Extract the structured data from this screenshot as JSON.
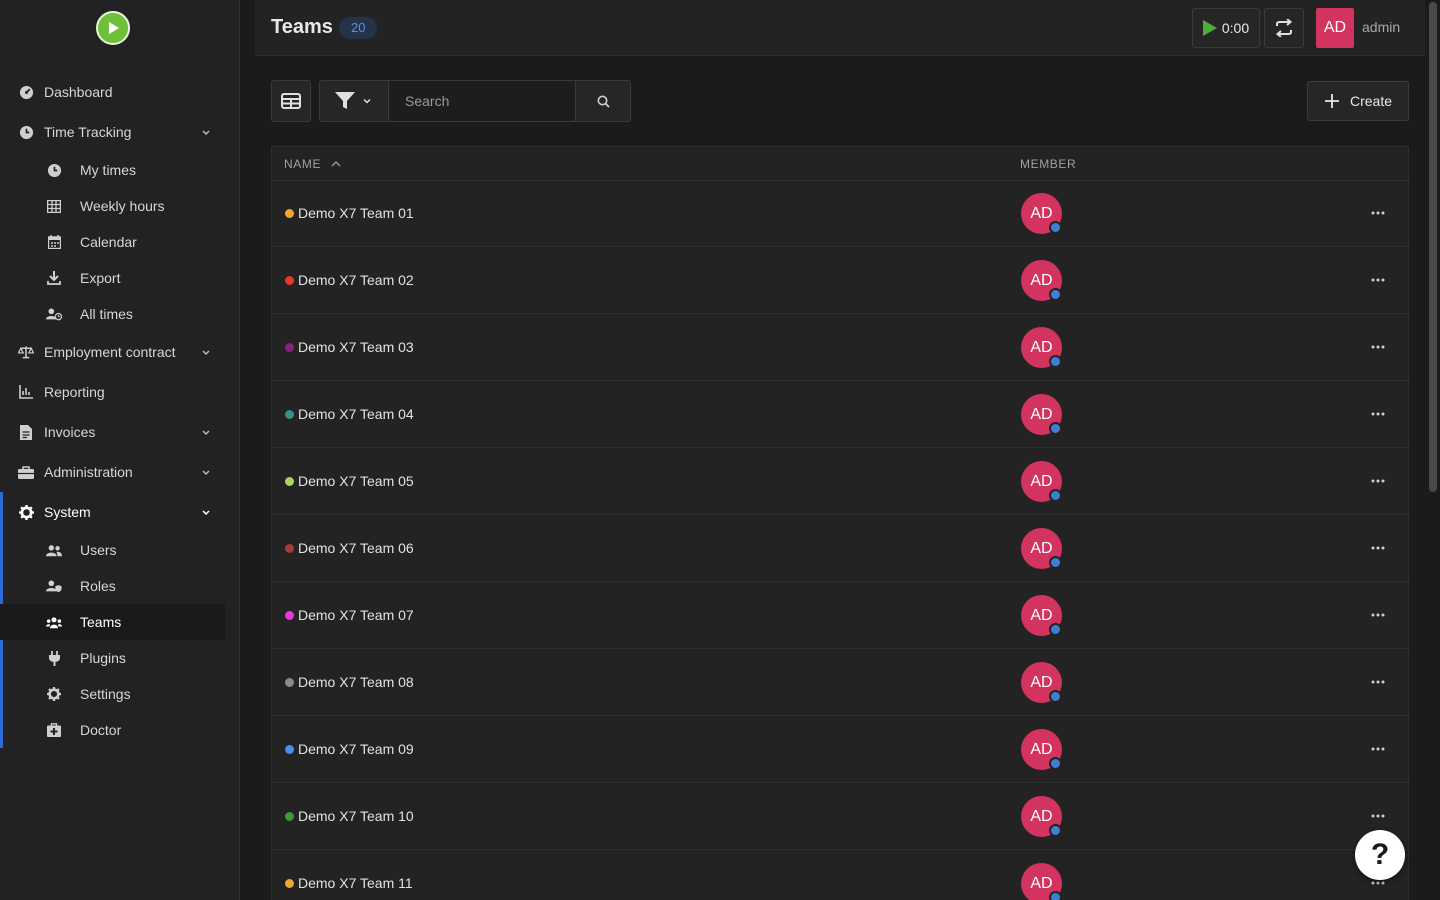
{
  "colors": {
    "accent": "#2f6bd6",
    "avatar": "#d2335f",
    "logo": "#6fbf3a",
    "status": "#3f7fd1"
  },
  "sidebar": {
    "logo_icon": "play-circle-logo",
    "items": [
      {
        "label": "Dashboard",
        "icon": "gauge-icon"
      },
      {
        "label": "Time Tracking",
        "icon": "clock-icon",
        "expandable": true,
        "children": [
          {
            "label": "My times",
            "icon": "clock-icon"
          },
          {
            "label": "Weekly hours",
            "icon": "table-icon"
          },
          {
            "label": "Calendar",
            "icon": "calendar-icon"
          },
          {
            "label": "Export",
            "icon": "download-icon"
          },
          {
            "label": "All times",
            "icon": "user-clock-icon"
          }
        ]
      },
      {
        "label": "Employment contract",
        "icon": "scale-icon",
        "expandable": true
      },
      {
        "label": "Reporting",
        "icon": "chart-icon"
      },
      {
        "label": "Invoices",
        "icon": "invoice-icon",
        "expandable": true
      },
      {
        "label": "Administration",
        "icon": "toolbox-icon",
        "expandable": true
      },
      {
        "label": "System",
        "icon": "gear-icon",
        "expandable": true,
        "children": [
          {
            "label": "Users",
            "icon": "users-icon"
          },
          {
            "label": "Roles",
            "icon": "user-shield-icon"
          },
          {
            "label": "Teams",
            "icon": "team-icon",
            "active": true
          },
          {
            "label": "Plugins",
            "icon": "plug-icon"
          },
          {
            "label": "Settings",
            "icon": "gear-icon"
          },
          {
            "label": "Doctor",
            "icon": "medkit-icon"
          }
        ]
      }
    ]
  },
  "header": {
    "title": "Teams",
    "count": "20",
    "timer": "0:00",
    "user_initials": "AD",
    "user_name": "admin"
  },
  "toolbar": {
    "search_placeholder": "Search",
    "create_label": "Create"
  },
  "table": {
    "columns": {
      "name": "NAME",
      "member": "MEMBER"
    },
    "rows": [
      {
        "name": "Demo X7 Team 01",
        "color": "#f2a33a",
        "member": "AD"
      },
      {
        "name": "Demo X7 Team 02",
        "color": "#e8392b",
        "member": "AD"
      },
      {
        "name": "Demo X7 Team 03",
        "color": "#8a1f7c",
        "member": "AD"
      },
      {
        "name": "Demo X7 Team 04",
        "color": "#3a8f87",
        "member": "AD"
      },
      {
        "name": "Demo X7 Team 05",
        "color": "#a6d65a",
        "member": "AD"
      },
      {
        "name": "Demo X7 Team 06",
        "color": "#a33a36",
        "member": "AD"
      },
      {
        "name": "Demo X7 Team 07",
        "color": "#e83ad8",
        "member": "AD"
      },
      {
        "name": "Demo X7 Team 08",
        "color": "#8a8a8a",
        "member": "AD"
      },
      {
        "name": "Demo X7 Team 09",
        "color": "#4a8ef2",
        "member": "AD"
      },
      {
        "name": "Demo X7 Team 10",
        "color": "#3c9a35",
        "member": "AD"
      },
      {
        "name": "Demo X7 Team 11",
        "color": "#f2a33a",
        "member": "AD"
      }
    ]
  },
  "help": {
    "label": "?"
  }
}
